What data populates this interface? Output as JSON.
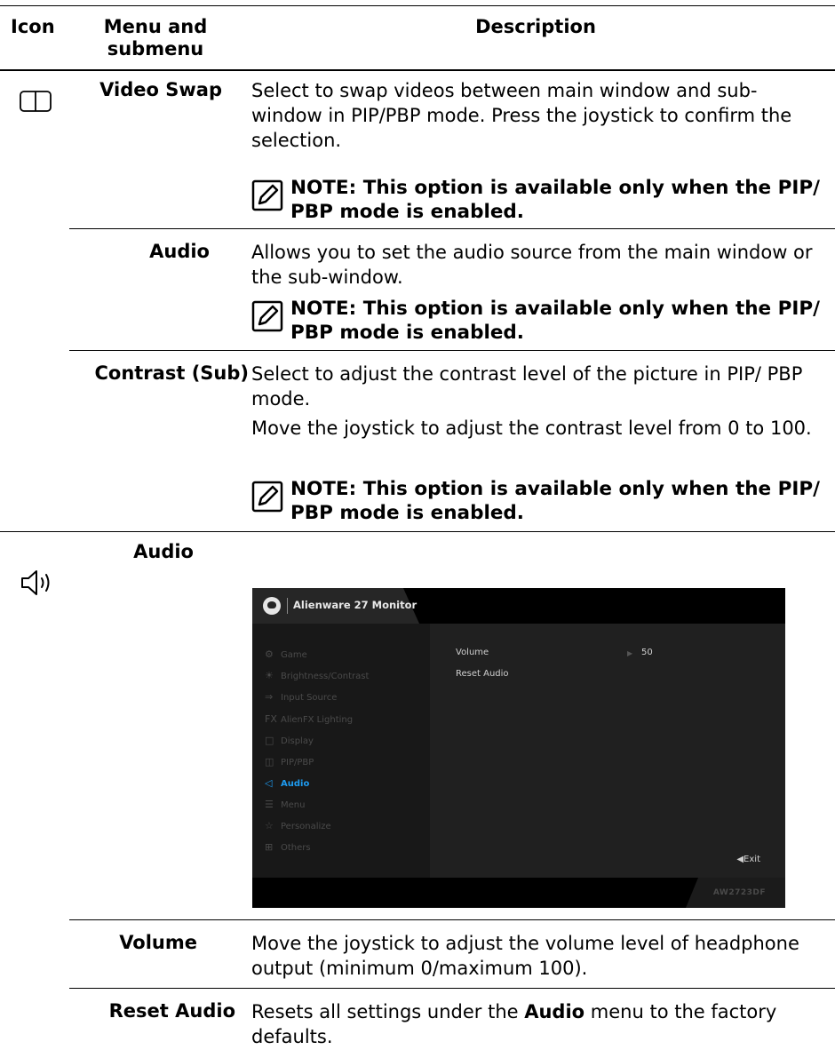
{
  "header": {
    "icon": "Icon",
    "menu": "Menu and\nsubmenu",
    "description": "Description"
  },
  "rows": {
    "video_swap": {
      "icon": "pip-pbp-icon",
      "menu": "Video Swap",
      "description": "Select to swap videos between main window and sub-window in PIP/PBP mode. Press the joystick to confirm the selection.",
      "note": "NOTE: This option is available only when the PIP/ PBP mode is enabled."
    },
    "audio_sub": {
      "menu": "Audio",
      "description": "Allows you to set the audio source from the main window or the sub-window.",
      "note": "NOTE: This option is available only when the PIP/ PBP mode is enabled."
    },
    "contrast_sub": {
      "menu": "Contrast (Sub)",
      "description": "Select to adjust the contrast level of the picture in PIP/ PBP mode.",
      "description2": "Move the joystick to adjust the contrast level from 0 to 100.",
      "note": "NOTE: This option is available only when the PIP/ PBP mode is enabled."
    },
    "audio": {
      "icon": "speaker-icon",
      "menu": "Audio"
    },
    "volume": {
      "menu": "Volume",
      "description": "Move the joystick to adjust the volume level of headphone output (minimum 0/maximum 100)."
    },
    "reset_audio": {
      "menu": "Reset Audio",
      "description_pre": "Resets all settings under the ",
      "description_bold": "Audio",
      "description_post": " menu to the factory defaults."
    }
  },
  "osd": {
    "title": "Alienware 27 Monitor",
    "menu_items": [
      {
        "icon": "gamepad-icon",
        "label": "Game"
      },
      {
        "icon": "brightness-icon",
        "label": "Brightness/Contrast"
      },
      {
        "icon": "input-source-icon",
        "label": "Input Source"
      },
      {
        "icon": "fx-icon",
        "label": "AlienFX Lighting"
      },
      {
        "icon": "display-icon",
        "label": "Display"
      },
      {
        "icon": "pip-icon",
        "label": "PIP/PBP"
      },
      {
        "icon": "speaker-icon",
        "label": "Audio"
      },
      {
        "icon": "menu-icon",
        "label": "Menu"
      },
      {
        "icon": "star-icon",
        "label": "Personalize"
      },
      {
        "icon": "others-icon",
        "label": "Others"
      }
    ],
    "active_item": "Audio",
    "options": {
      "volume_label": "Volume",
      "volume_value": "50",
      "reset_label": "Reset Audio"
    },
    "exit": "◀Exit",
    "model": "AW2723DF",
    "colors": {
      "active": "#1e9bf0"
    }
  }
}
